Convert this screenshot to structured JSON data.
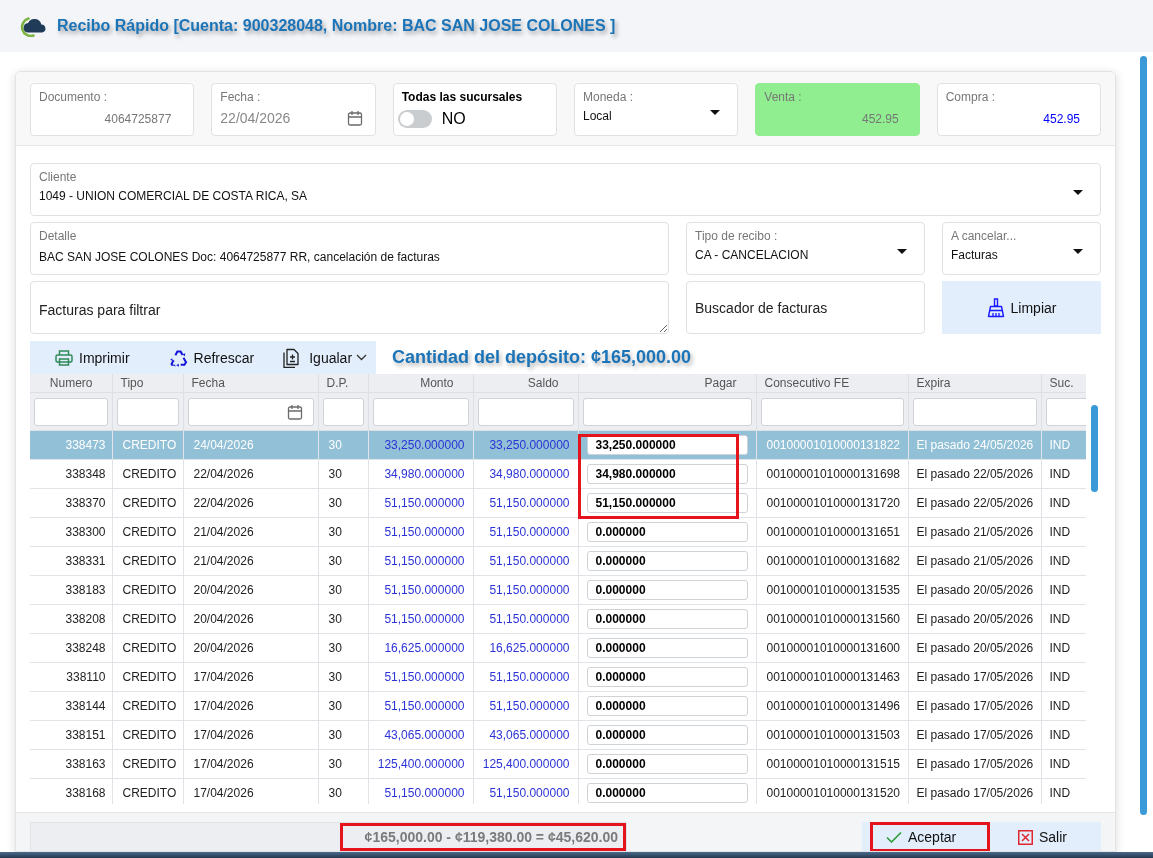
{
  "window": {
    "title": "Recibo Rápido [Cuenta: 900328048, Nombre: BAC SAN JOSE COLONES ]"
  },
  "header_fields": [
    {
      "kind": "number",
      "label": "Documento :",
      "value": "4064725877"
    },
    {
      "kind": "date",
      "label": "Fecha :",
      "value": "22/04/2026"
    },
    {
      "kind": "toggle",
      "label": "Todas las sucursales",
      "on": false,
      "value": "NO"
    },
    {
      "kind": "select",
      "label": "Moneda :",
      "value": "Local"
    }
  ],
  "exchange_rates": [
    {
      "label": "Venta :",
      "value": "452.95",
      "selected": true
    },
    {
      "label": "Compra :",
      "value": "452.95",
      "selected": false
    }
  ],
  "client": {
    "label": "Cliente",
    "value": "1049 - UNION COMERCIAL DE COSTA RICA, SA"
  },
  "receipt_fields": [
    {
      "kind": "text",
      "label": "Detalle",
      "value": "BAC SAN JOSE COLONES Doc: 4064725877 RR, cancelación de facturas"
    },
    {
      "kind": "select",
      "label": "Tipo de recibo :",
      "value": "CA - CANCELACION"
    },
    {
      "kind": "select",
      "label": "A cancelar...",
      "value": "Facturas"
    }
  ],
  "invoice_filter": {
    "placeholder": "Facturas para filtrar"
  },
  "invoice_search": {
    "placeholder": "Buscador de facturas"
  },
  "clear_button": {
    "label": "Limpiar"
  },
  "toolbar": [
    {
      "kind": "print",
      "label": "Imprimir",
      "dropdown": false
    },
    {
      "kind": "refresh",
      "label": "Refrescar",
      "dropdown": false
    },
    {
      "kind": "match",
      "label": "Igualar",
      "dropdown": true
    }
  ],
  "deposit_amount": "Cantidad del depósito: ¢165,000.00",
  "table": {
    "columns": [
      {
        "kind": "id",
        "label": "Numero"
      },
      {
        "kind": "type",
        "label": "Tipo"
      },
      {
        "kind": "date",
        "label": "Fecha"
      },
      {
        "kind": "days",
        "label": "D.P."
      },
      {
        "kind": "amount",
        "label": "Monto"
      },
      {
        "kind": "amount",
        "label": "Saldo"
      },
      {
        "kind": "payment",
        "label": "Pagar"
      },
      {
        "kind": "code",
        "label": "Consecutivo FE"
      },
      {
        "kind": "expiry",
        "label": "Expira"
      },
      {
        "kind": "branch",
        "label": "Suc."
      }
    ],
    "rows": [
      {
        "cells": [
          "338473",
          "CREDITO",
          "24/04/2026",
          "30",
          "33,250.000000",
          "33,250.000000",
          "33,250.000000",
          "00100001010000131822",
          "El pasado 24/05/2026",
          "IND"
        ],
        "selected": true,
        "highlighted": true
      },
      {
        "cells": [
          "338348",
          "CREDITO",
          "22/04/2026",
          "30",
          "34,980.000000",
          "34,980.000000",
          "34,980.000000",
          "00100001010000131698",
          "El pasado 22/05/2026",
          "IND"
        ],
        "selected": false,
        "highlighted": true
      },
      {
        "cells": [
          "338370",
          "CREDITO",
          "22/04/2026",
          "30",
          "51,150.000000",
          "51,150.000000",
          "51,150.000000",
          "00100001010000131720",
          "El pasado 22/05/2026",
          "IND"
        ],
        "selected": false,
        "highlighted": true
      },
      {
        "cells": [
          "338300",
          "CREDITO",
          "21/04/2026",
          "30",
          "51,150.000000",
          "51,150.000000",
          "0.000000",
          "00100001010000131651",
          "El pasado 21/05/2026",
          "IND"
        ],
        "selected": false,
        "highlighted": false
      },
      {
        "cells": [
          "338331",
          "CREDITO",
          "21/04/2026",
          "30",
          "51,150.000000",
          "51,150.000000",
          "0.000000",
          "00100001010000131682",
          "El pasado 21/05/2026",
          "IND"
        ],
        "selected": false,
        "highlighted": false
      },
      {
        "cells": [
          "338183",
          "CREDITO",
          "20/04/2026",
          "30",
          "51,150.000000",
          "51,150.000000",
          "0.000000",
          "00100001010000131535",
          "El pasado 20/05/2026",
          "IND"
        ],
        "selected": false,
        "highlighted": false
      },
      {
        "cells": [
          "338208",
          "CREDITO",
          "20/04/2026",
          "30",
          "51,150.000000",
          "51,150.000000",
          "0.000000",
          "00100001010000131560",
          "El pasado 20/05/2026",
          "IND"
        ],
        "selected": false,
        "highlighted": false
      },
      {
        "cells": [
          "338248",
          "CREDITO",
          "20/04/2026",
          "30",
          "16,625.000000",
          "16,625.000000",
          "0.000000",
          "00100001010000131600",
          "El pasado 20/05/2026",
          "IND"
        ],
        "selected": false,
        "highlighted": false
      },
      {
        "cells": [
          "338110",
          "CREDITO",
          "17/04/2026",
          "30",
          "51,150.000000",
          "51,150.000000",
          "0.000000",
          "00100001010000131463",
          "El pasado 17/05/2026",
          "IND"
        ],
        "selected": false,
        "highlighted": false
      },
      {
        "cells": [
          "338144",
          "CREDITO",
          "17/04/2026",
          "30",
          "51,150.000000",
          "51,150.000000",
          "0.000000",
          "00100001010000131496",
          "El pasado 17/05/2026",
          "IND"
        ],
        "selected": false,
        "highlighted": false
      },
      {
        "cells": [
          "338151",
          "CREDITO",
          "17/04/2026",
          "30",
          "43,065.000000",
          "43,065.000000",
          "0.000000",
          "00100001010000131503",
          "El pasado 17/05/2026",
          "IND"
        ],
        "selected": false,
        "highlighted": false
      },
      {
        "cells": [
          "338163",
          "CREDITO",
          "17/04/2026",
          "30",
          "125,400.000000",
          "125,400.000000",
          "0.000000",
          "00100001010000131515",
          "El pasado 17/05/2026",
          "IND"
        ],
        "selected": false,
        "highlighted": false
      },
      {
        "cells": [
          "338168",
          "CREDITO",
          "17/04/2026",
          "30",
          "51,150.000000",
          "51,150.000000",
          "0.000000",
          "00100001010000131520",
          "El pasado 17/05/2026",
          "IND"
        ],
        "selected": false,
        "highlighted": false
      }
    ]
  },
  "footer": {
    "total": {
      "text": "¢165,000.00 - ¢119,380.00 = ¢45,620.00",
      "highlighted": true
    },
    "buttons": [
      {
        "kind": "accept",
        "label": "Aceptar",
        "highlighted": true
      },
      {
        "kind": "exit",
        "label": "Salir",
        "highlighted": false
      }
    ]
  }
}
